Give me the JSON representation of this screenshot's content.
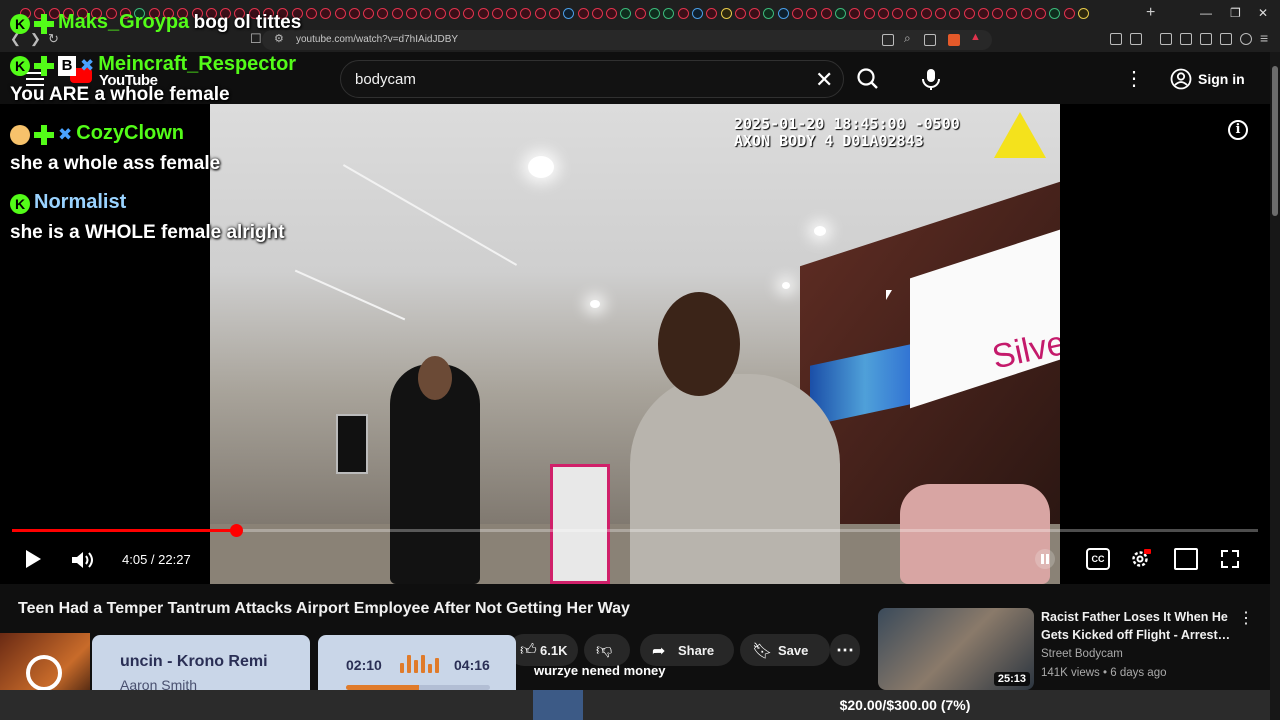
{
  "browser": {
    "url": "youtube.com/watch?v=d7hIAidJDBY",
    "window_controls": [
      "—",
      "❐",
      "✕"
    ]
  },
  "youtube": {
    "logo_text": "YouTube",
    "search_value": "bodycam",
    "sign_in": "Sign in",
    "video": {
      "timestamp_line1": "2025-01-20 18:45:00 -0500",
      "timestamp_line2": "AXON BODY 4 D01A02843",
      "sign_text": "Silver",
      "time_display": "4:05 / 22:27",
      "progress_fraction": 0.18,
      "title": "Teen Had a Temper Tantrum Attacks Airport Employee After Not Getting Her Way"
    },
    "actions": {
      "like_count": "6.1K",
      "share": "Share",
      "save": "Save"
    },
    "recommendation": {
      "title": "Racist Father Loses It When He Gets Kicked off Flight - Arrest…",
      "channel": "Street Bodycam",
      "meta": "141K views • 6 days ago",
      "duration": "25:13"
    }
  },
  "chat": [
    {
      "name": "Maks_Groypa",
      "name_color": "#53fc18",
      "message": "bog ol tittes"
    },
    {
      "name": "Meincraft_Respector",
      "name_color": "#53fc18",
      "message": "You ARE a whole female"
    },
    {
      "name": "CozyClown",
      "name_color": "#53fc18",
      "message": "she a whole ass female"
    },
    {
      "name": "Normalist",
      "name_color": "#9ad3ff",
      "message": "she is a WHOLE female alright"
    }
  ],
  "music": {
    "track": "uncin - Krono Remi",
    "artist": "Aaron Smith",
    "elapsed": "02:10",
    "total": "04:16",
    "progress_fraction": 0.51
  },
  "ticker_text": "wurzye nened money",
  "goal": {
    "text": "$20.00/$300.00 (7%)",
    "fraction": 0.07
  }
}
